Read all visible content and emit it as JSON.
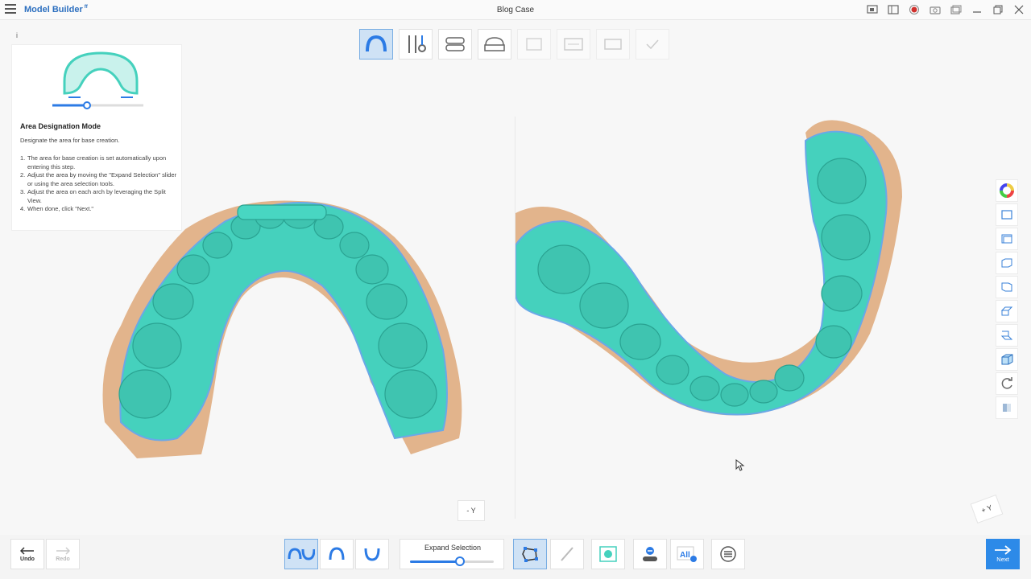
{
  "titlebar": {
    "app_name": "Model Builder",
    "app_badge": "ff",
    "case_title": "Blog Case"
  },
  "help": {
    "info_glyph": "i",
    "title": "Area Designation Mode",
    "subtitle": "Designate the area for base creation.",
    "steps": [
      {
        "num": "1.",
        "text": "The area for base creation is set automatically upon entering this step."
      },
      {
        "num": "2.",
        "text": "Adjust the area by moving the \"Expand Selection\" slider or using the area selection tools."
      },
      {
        "num": "3.",
        "text": "Adjust the area on each arch by leveraging the Split View."
      },
      {
        "num": "4.",
        "text": "When done, click \"Next.\""
      }
    ]
  },
  "views": {
    "left_axis": "- Y",
    "right_axis": "+ Y"
  },
  "bottom": {
    "undo_label": "Undo",
    "redo_label": "Redo",
    "slider_label": "Expand Selection",
    "slider_value": 0.6,
    "next_label": "Next",
    "all_label": "All"
  },
  "colors": {
    "accent": "#2c7be5",
    "scan_teal": "#45d1bd",
    "gum_tan": "#e2b48c"
  }
}
